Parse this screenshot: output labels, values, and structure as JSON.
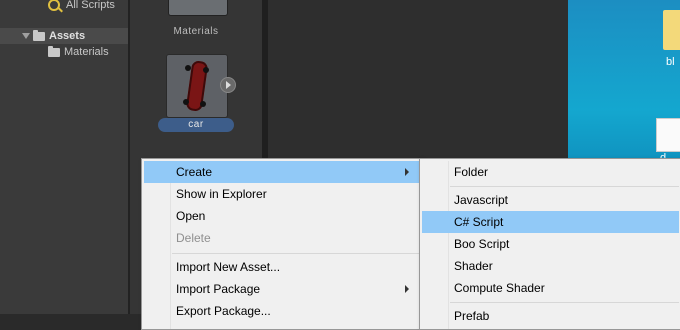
{
  "project_tree": {
    "all_scripts": "All Scripts",
    "assets": "Assets",
    "materials": "Materials"
  },
  "asset_grid": {
    "materials_label": "Materials",
    "car_label": "car"
  },
  "desktop": {
    "folder_label": "bl",
    "doc_label": "d"
  },
  "context_menu": {
    "items": [
      {
        "label": "Create",
        "submenu": true,
        "highlighted": true
      },
      {
        "label": "Show in Explorer"
      },
      {
        "label": "Open"
      },
      {
        "label": "Delete",
        "disabled": true
      },
      {
        "label": "Import New Asset..."
      },
      {
        "label": "Import Package",
        "submenu": true
      },
      {
        "label": "Export Package..."
      }
    ]
  },
  "create_submenu": {
    "items": [
      {
        "label": "Folder"
      },
      {
        "label": "Javascript"
      },
      {
        "label": "C# Script",
        "highlighted": true
      },
      {
        "label": "Boo Script"
      },
      {
        "label": "Shader"
      },
      {
        "label": "Compute Shader"
      },
      {
        "label": "Prefab"
      }
    ]
  },
  "colors": {
    "menu_highlight": "#91c9f7",
    "selection_label": "#3d5d8a",
    "desktop": "#14a7cf"
  }
}
